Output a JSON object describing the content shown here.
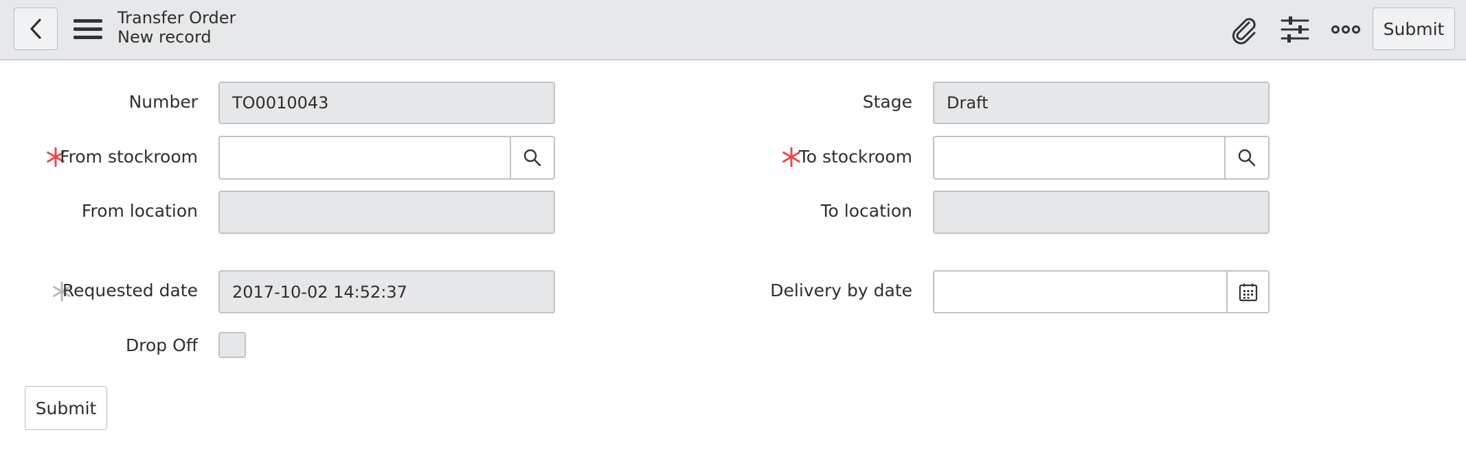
{
  "header": {
    "title": "Transfer Order",
    "subtitle": "New record",
    "submit_label": "Submit",
    "icons": [
      "back-icon",
      "menu-icon",
      "paperclip-icon",
      "sliders-icon",
      "more-icon"
    ]
  },
  "form": {
    "number": {
      "label": "Number",
      "value": "TO0010043"
    },
    "stage": {
      "label": "Stage",
      "value": "Draft"
    },
    "from_stockroom": {
      "label": "From stockroom",
      "value": "",
      "required": true
    },
    "to_stockroom": {
      "label": "To stockroom",
      "value": "",
      "required": true
    },
    "from_location": {
      "label": "From location",
      "value": ""
    },
    "to_location": {
      "label": "To location",
      "value": ""
    },
    "requested_date": {
      "label": "Requested date",
      "value": "2017-10-02 14:52:37",
      "required": true
    },
    "delivery_by_date": {
      "label": "Delivery by date",
      "value": ""
    },
    "drop_off": {
      "label": "Drop Off",
      "checked": false
    }
  },
  "footer": {
    "submit_label": "Submit"
  },
  "colors": {
    "header_bg": "#e6e8ea",
    "required_active": "#e8474b",
    "required_filled": "#b5b9bd",
    "readonly_bg": "#e6e7e9",
    "border": "#bfc3c7"
  }
}
